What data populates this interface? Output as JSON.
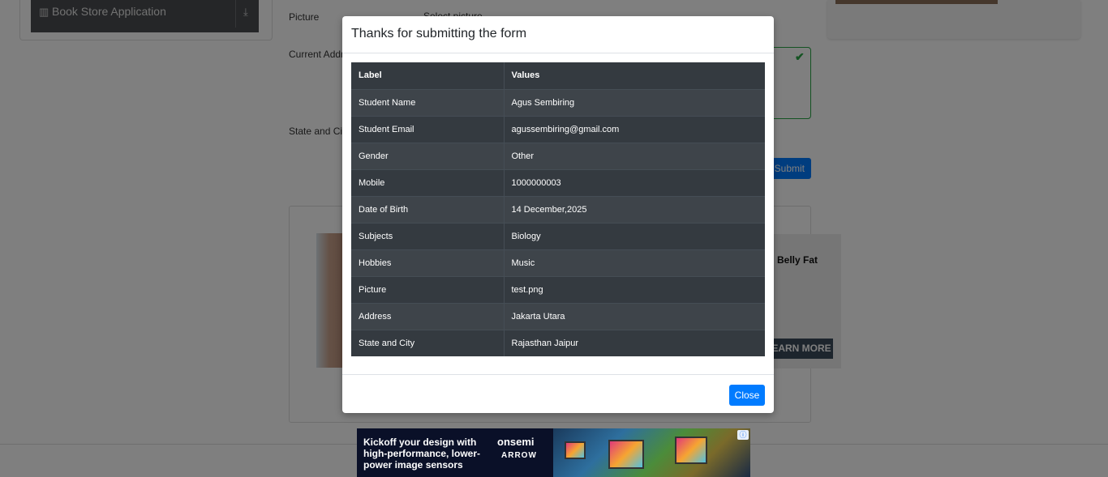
{
  "background": {
    "sidebar": {
      "group_label": "Book Store Application",
      "group_icon": "book-icon",
      "collapse_icon": "download-icon"
    },
    "form": {
      "picture_label": "Picture",
      "picture_hint": "Select picture",
      "address_label": "Current Address",
      "state_city_label": "State and City",
      "submit_label": "Submit"
    },
    "ad": {
      "headline": "Belly Fat",
      "cta": "LEARN MORE →"
    }
  },
  "modal": {
    "title": "Thanks for submitting the form",
    "table": {
      "headers": [
        "Label",
        "Values"
      ],
      "rows": [
        [
          "Student Name",
          "Agus Sembiring"
        ],
        [
          "Student Email",
          "agussembiring@gmail.com"
        ],
        [
          "Gender",
          "Other"
        ],
        [
          "Mobile",
          "1000000003"
        ],
        [
          "Date of Birth",
          "14 December,2025"
        ],
        [
          "Subjects",
          "Biology"
        ],
        [
          "Hobbies",
          "Music"
        ],
        [
          "Picture",
          "test.png"
        ],
        [
          "Address",
          "Jakarta Utara"
        ],
        [
          "State and City",
          "Rajasthan Jaipur"
        ]
      ]
    },
    "close_label": "Close"
  },
  "banner": {
    "line1": "Kickoff your design with",
    "line2": "high-performance, lower-",
    "line3": "power image sensors",
    "brand1": "onsemi",
    "brand2": "ARROW"
  },
  "colors": {
    "primary": "#007bff",
    "table_dark": "#343a40",
    "valid": "#28a745"
  }
}
